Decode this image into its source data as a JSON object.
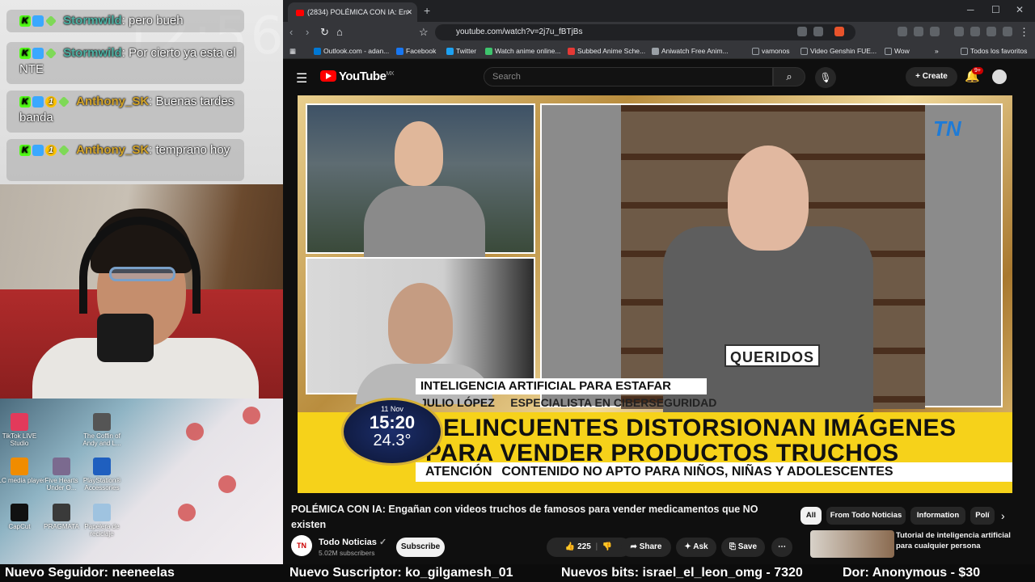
{
  "overlay": {
    "clock_faded": "56",
    "chat": [
      {
        "user": "Stormwild",
        "text": ": pero bueh",
        "color": "#4fb3a5"
      },
      {
        "user": "Stormwild",
        "text": ": Por cierto ya esta el NTE",
        "color": "#4fb3a5"
      },
      {
        "user": "Anthony_SK",
        "text": ": Buenas tardes banda",
        "color": "#d4a52b"
      },
      {
        "user": "Anthony_SK",
        "text": ": temprano hoy",
        "color": "#d4a52b"
      }
    ],
    "desktop_icons": [
      {
        "label": "TikTok LIVE Studio"
      },
      {
        "label": "The Coffin of Andy and L..."
      },
      {
        "label": "VLC media player"
      },
      {
        "label": "Five Hearts Under O..."
      },
      {
        "label": "PlayStation® Accessories"
      },
      {
        "label": "CapCut"
      },
      {
        "label": "PRAGMATA"
      },
      {
        "label": "Papelera de reciclaje"
      }
    ]
  },
  "browser": {
    "tab_title": "(2834) POLÉMICA CON IA: En",
    "url": "youtube.com/watch?v=2j7u_fBTjBs",
    "bookmarks": [
      {
        "label": "Outlook.com - adan...",
        "color": "#0078d4"
      },
      {
        "label": "Facebook",
        "color": "#1877f2"
      },
      {
        "label": "Twitter",
        "color": "#1da1f2"
      },
      {
        "label": "Watch anime online...",
        "color": "#3ec46d"
      },
      {
        "label": "Subbed Anime Sche...",
        "color": "#e53935"
      },
      {
        "label": "Aniwatch Free Anim...",
        "color": "#9aa0a6"
      },
      {
        "label": "vamonos",
        "color": "#9aa0a6"
      },
      {
        "label": "Video Genshin FUE...",
        "color": "#9aa0a6"
      },
      {
        "label": "Wow",
        "color": "#9aa0a6"
      },
      {
        "label": "Todos los favoritos",
        "color": "#9aa0a6"
      }
    ]
  },
  "youtube": {
    "logo": "YouTube",
    "region": "MX",
    "search_placeholder": "Search",
    "create_label": "Create",
    "notif_count": "9+",
    "video": {
      "tn_logo": "TN",
      "queridos": "QUERIDOS",
      "lower1": "INTELIGENCIA ARTIFICIAL PARA ESTAFAR",
      "lower2_name": "JULIO LÓPEZ",
      "lower2_role": "ESPECIALISTA EN CIBERSEGURIDAD",
      "headline1": "DELINCUENTES DISTORSIONAN IMÁGENES",
      "headline2": "PARA VENDER PRODUCTOS TRUCHOS",
      "atencion": "ATENCIÓN",
      "warning": "CONTENIDO NO APTO PARA NIÑOS, NIÑAS Y ADOLESCENTES",
      "clock_date": "11 Nov",
      "clock_time": "15:20",
      "clock_temp": "24.3°"
    },
    "title": "POLÉMICA CON IA: Engañan con videos truchos de famosos para vender medicamentos que NO existen",
    "channel": {
      "name": "Todo Noticias",
      "subs": "5.02M subscribers",
      "avatar": "TN"
    },
    "subscribe_label": "Subscribe",
    "likes": "225",
    "share_label": "Share",
    "ask_label": "Ask",
    "save_label": "Save",
    "chips": [
      "All",
      "From Todo Noticias",
      "Information",
      "Polí"
    ],
    "reco_title": "Tutorial de inteligencia artificial para cualquier persona"
  },
  "ticker": {
    "follower": "Nuevo Seguidor: neeneelas",
    "subscriber": "Nuevo Suscriptor: ko_gilgamesh_01",
    "bits": "Nuevos bits: israel_el_leon_omg - 7320",
    "donor": "Dor: Anonymous - $30"
  }
}
